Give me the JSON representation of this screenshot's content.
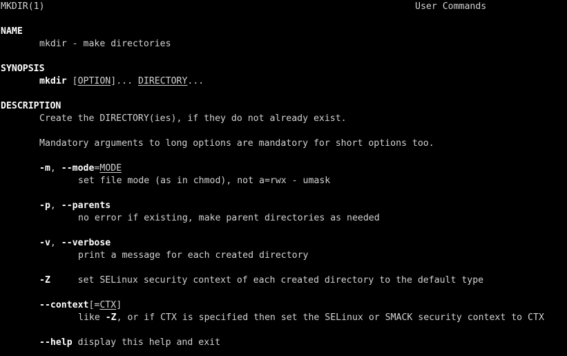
{
  "header": {
    "left": "MKDIR(1)",
    "center": "User Commands"
  },
  "name": {
    "heading": "NAME",
    "text": "mkdir - make directories"
  },
  "synopsis": {
    "heading": "SYNOPSIS",
    "command": "mkdir",
    "sp": " ",
    "open1": "[",
    "option": "OPTION",
    "close1": "]... ",
    "directory": "DIRECTORY",
    "ellipsis": "..."
  },
  "description": {
    "heading": "DESCRIPTION",
    "line1": "Create the DIRECTORY(ies), if they do not already exist.",
    "line2": "Mandatory arguments to long options are mandatory for short options too."
  },
  "options": {
    "mode": {
      "short": "-m",
      "sep": ", ",
      "long": "--mode",
      "eq": "=",
      "arg": "MODE",
      "desc": "set file mode (as in chmod), not a=rwx - umask"
    },
    "parents": {
      "short": "-p",
      "sep": ", ",
      "long": "--parents",
      "desc": "no error if existing, make parent directories as needed"
    },
    "verbose": {
      "short": "-v",
      "sep": ", ",
      "long": "--verbose",
      "desc": "print a message for each created directory"
    },
    "z": {
      "short": "-Z",
      "gap": "     ",
      "desc": "set SELinux security context of each created directory to the default type"
    },
    "context": {
      "long": "--context",
      "open": "[=",
      "arg": "CTX",
      "close": "]",
      "desc_pre": "like ",
      "desc_flag": "-Z",
      "desc_post": ", or if CTX is specified then set the SELinux or SMACK security context to CTX"
    },
    "help": {
      "long": "--help",
      "desc": " display this help and exit"
    }
  }
}
